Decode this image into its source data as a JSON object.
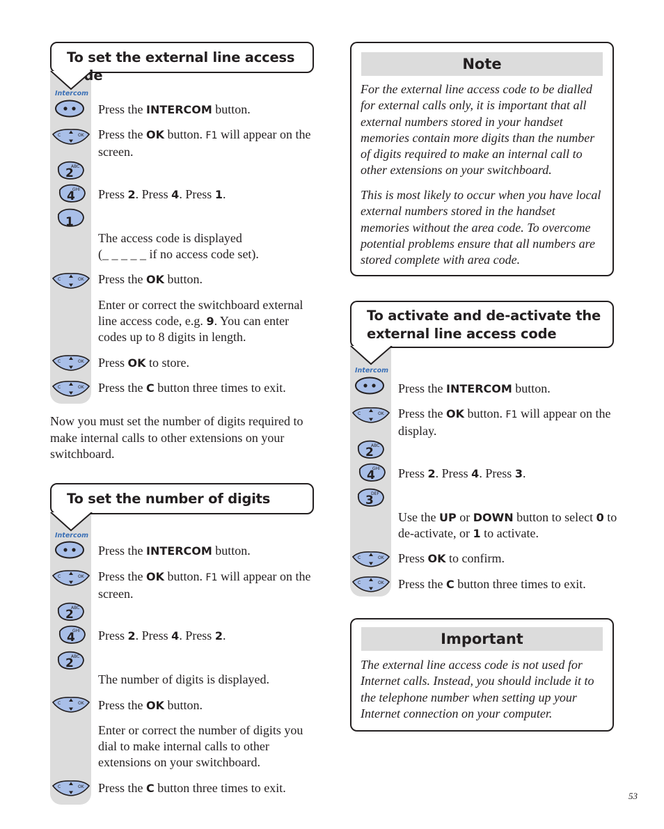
{
  "page_number": "53",
  "colors": {
    "button_fill": "#a9bfe8",
    "intercom_label": "#3a6fb5",
    "grey_bar": "#dcdcdc",
    "ink": "#231f20"
  },
  "icons": {
    "intercom": "intercom-button-icon",
    "nav": "ok-navigation-button-icon",
    "key": "keypad-key-icon"
  },
  "intercom_label": "Intercom",
  "section1": {
    "title": "To set the external line access code",
    "steps": [
      {
        "icon": "intercom",
        "pre": "Press the ",
        "bold": "INTERCOM",
        "post": " button."
      },
      {
        "icon": "nav",
        "pre": "Press the ",
        "bold": "OK",
        "mid": " button. ",
        "code": "F1",
        "post": " will appear on the screen."
      },
      {
        "keys": [
          {
            "digit": "2",
            "letters": "ABC"
          },
          {
            "digit": "4",
            "letters": "GHI"
          },
          {
            "digit": "1",
            "letters": ""
          }
        ],
        "text_parts": [
          "Press ",
          "2",
          ". Press ",
          "4",
          ". Press ",
          "1",
          "."
        ]
      },
      {
        "text": "The access code is displayed",
        "text2": "(_ _ _ _ _ if no access code set)."
      },
      {
        "icon": "nav",
        "pre": "Press the ",
        "bold": "OK",
        "post": " button."
      },
      {
        "pre": "Enter or correct the switchboard external line access code, e.g. ",
        "bold": "9",
        "post": ". You can enter codes up to 8 digits in length."
      },
      {
        "icon": "nav",
        "pre": "Press ",
        "bold": "OK",
        "post": " to store."
      },
      {
        "icon": "nav",
        "pre": "Press the ",
        "bold": "C",
        "post": " button three times to exit."
      }
    ]
  },
  "interlude": "Now you must set the number of digits required to make internal calls to other extensions on your switchboard.",
  "section2": {
    "title": "To set the number of digits",
    "steps": [
      {
        "icon": "intercom",
        "pre": "Press the ",
        "bold": "INTERCOM",
        "post": " button."
      },
      {
        "icon": "nav",
        "pre": "Press the ",
        "bold": "OK",
        "mid": " button. ",
        "code": "F1",
        "post": " will appear on the screen."
      },
      {
        "keys": [
          {
            "digit": "2",
            "letters": "ABC"
          },
          {
            "digit": "4",
            "letters": "GHI"
          },
          {
            "digit": "2",
            "letters": "ABC"
          }
        ],
        "text_parts": [
          "Press ",
          "2",
          ". Press ",
          "4",
          ". Press ",
          "2",
          "."
        ]
      },
      {
        "text": "The number of digits is displayed."
      },
      {
        "icon": "nav",
        "pre": "Press the ",
        "bold": "OK",
        "post": " button."
      },
      {
        "text": "Enter or correct the number of digits you dial to make internal calls to other extensions on your switchboard."
      },
      {
        "icon": "nav",
        "pre": "Press the ",
        "bold": "C",
        "post": " button three times to exit."
      }
    ]
  },
  "note": {
    "heading": "Note",
    "paragraphs": [
      "For the external line access code to be dialled for external calls only, it is important that all external numbers stored in your handset memories contain more digits than the number of digits required to make an internal call to other extensions on your switchboard.",
      "This is most likely to occur when you have local external numbers stored in the handset memories without the area code. To overcome potential problems ensure that all numbers are stored complete with area code."
    ]
  },
  "section3": {
    "title_line1": "To activate and de-activate the",
    "title_line2": "external line access code",
    "steps": [
      {
        "icon": "intercom",
        "pre": "Press the ",
        "bold": "INTERCOM",
        "post": " button."
      },
      {
        "icon": "nav",
        "pre": "Press the ",
        "bold": "OK",
        "mid": " button. ",
        "code": "F1",
        "post": " will appear on the display."
      },
      {
        "keys": [
          {
            "digit": "2",
            "letters": "ABC"
          },
          {
            "digit": "4",
            "letters": "GHI"
          },
          {
            "digit": "3",
            "letters": "DEF"
          }
        ],
        "text_parts": [
          "Press ",
          "2",
          ". Press ",
          "4",
          ". Press ",
          "3",
          "."
        ]
      },
      {
        "parts": [
          "Use the ",
          "UP",
          " or ",
          "DOWN",
          " button to select ",
          "0",
          " to de-activate, or ",
          "1",
          " to activate."
        ]
      },
      {
        "icon": "nav",
        "pre": "Press ",
        "bold": "OK",
        "post": " to confirm."
      },
      {
        "icon": "nav",
        "pre": "Press the ",
        "bold": "C",
        "post": " button three times to exit."
      }
    ]
  },
  "important": {
    "heading": "Important",
    "paragraph": "The external line access code is not used for Internet calls. Instead, you should include it to the telephone number when setting up your Internet connection on your computer."
  }
}
